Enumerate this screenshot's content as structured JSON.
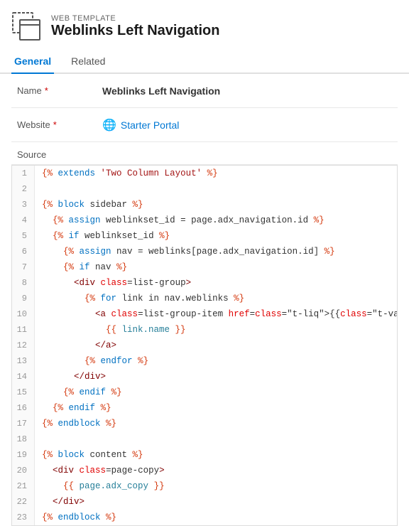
{
  "header": {
    "label": "WEB TEMPLATE",
    "title": "Weblinks Left Navigation"
  },
  "tabs": [
    {
      "id": "general",
      "label": "General",
      "active": true
    },
    {
      "id": "related",
      "label": "Related",
      "active": false
    }
  ],
  "form": {
    "fields": [
      {
        "label": "Name",
        "required": true,
        "value": "Weblinks Left Navigation",
        "bold": true
      },
      {
        "label": "Website",
        "required": true,
        "icon": "globe",
        "value": "Starter Portal",
        "isLink": true
      }
    ],
    "sourceLabel": "Source"
  },
  "code": {
    "lines": [
      {
        "num": 1,
        "content": "{% extends 'Two Column Layout' %}"
      },
      {
        "num": 2,
        "content": ""
      },
      {
        "num": 3,
        "content": "{% block sidebar %}"
      },
      {
        "num": 4,
        "content": "  {% assign weblinkset_id = page.adx_navigation.id %}"
      },
      {
        "num": 5,
        "content": "  {% if weblinkset_id %}"
      },
      {
        "num": 6,
        "content": "    {% assign nav = weblinks[page.adx_navigation.id] %}"
      },
      {
        "num": 7,
        "content": "    {% if nav %}"
      },
      {
        "num": 8,
        "content": "      <div class=list-group>"
      },
      {
        "num": 9,
        "content": "        {% for link in nav.weblinks %}"
      },
      {
        "num": 10,
        "content": "          <a class=list-group-item href={{ link.url }}>"
      },
      {
        "num": 11,
        "content": "            {{ link.name }}"
      },
      {
        "num": 12,
        "content": "          </a>"
      },
      {
        "num": 13,
        "content": "        {% endfor %}"
      },
      {
        "num": 14,
        "content": "      </div>"
      },
      {
        "num": 15,
        "content": "    {% endif %}"
      },
      {
        "num": 16,
        "content": "  {% endif %}"
      },
      {
        "num": 17,
        "content": "{% endblock %}"
      },
      {
        "num": 18,
        "content": ""
      },
      {
        "num": 19,
        "content": "{% block content %}"
      },
      {
        "num": 20,
        "content": "  <div class=page-copy>"
      },
      {
        "num": 21,
        "content": "    {{ page.adx_copy }}"
      },
      {
        "num": 22,
        "content": "  </div>"
      },
      {
        "num": 23,
        "content": "{% endblock %}"
      }
    ]
  }
}
